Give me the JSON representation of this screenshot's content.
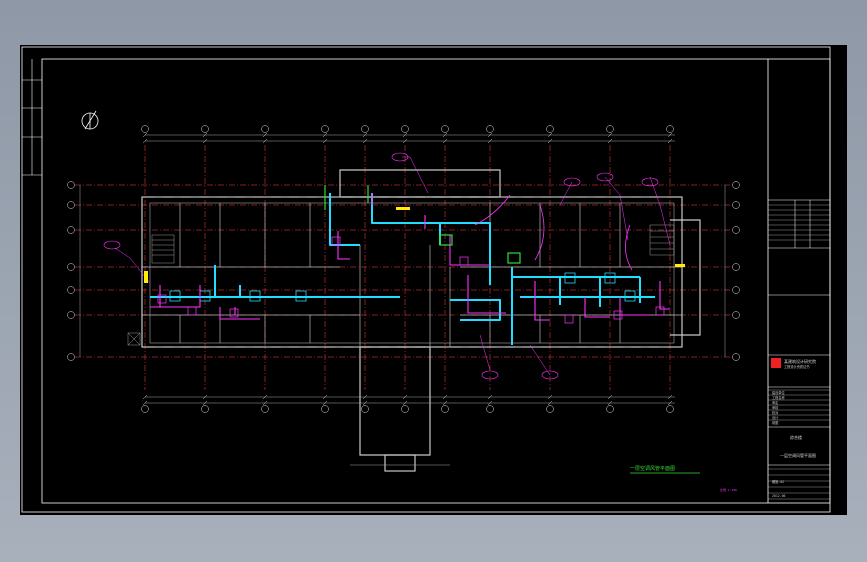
{
  "drawing": {
    "caption": "一层空调风管平面图",
    "scale_note": "比例 1:100"
  },
  "title_block": {
    "company_lines": [
      "某建筑设计研究院",
      "工程设计资质证书"
    ],
    "rows": [
      "建设单位",
      "工程名称",
      "审定",
      "审核",
      "校对",
      "设计",
      "制图"
    ],
    "project_label": "综合楼",
    "drawing_name": "一层空调风管平面图",
    "sheet_no": "暖施-02",
    "date": "2012.06"
  },
  "colors": {
    "background": "#000000",
    "frame": "#ffffff",
    "grid": "#ff4040",
    "walls": "#c8c8c8",
    "duct_supply": "#22ddff",
    "duct_return": "#ff33ff",
    "title": "#33dd33",
    "stamp": "#ee2222",
    "accent_yellow": "#ffee00"
  },
  "icons": [
    "north-arrow-icon",
    "company-logo-stamp"
  ]
}
